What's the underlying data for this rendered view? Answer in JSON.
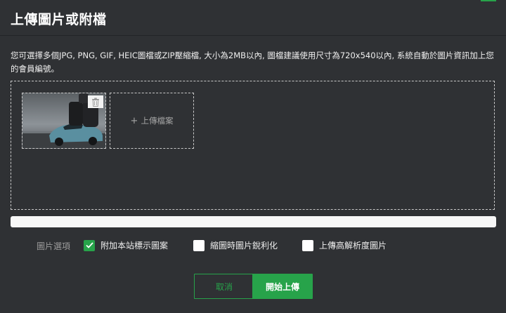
{
  "dialog": {
    "title": "上傳圖片或附檔",
    "description": "您可選擇多個JPG, PNG, GIF, HEIC圖檔或ZIP壓縮檔, 大小為2MB以內, 圖檔建議使用尺寸為720x540以內, 系統自動於圖片資訊加上您的會員編號。"
  },
  "dropzone": {
    "thumbnail": {
      "delete_icon": "trash-icon"
    },
    "upload_tile": {
      "icon": "plus-icon",
      "icon_glyph": "+",
      "label": "上傳檔案"
    }
  },
  "progress": {
    "fraction": 0
  },
  "options": {
    "label": "圖片選項",
    "items": [
      {
        "label": "附加本站標示圖案",
        "checked": true
      },
      {
        "label": "縮圖時圖片銳利化",
        "checked": false
      },
      {
        "label": "上傳高解析度圖片",
        "checked": false
      }
    ]
  },
  "buttons": {
    "cancel": "取消",
    "start": "開始上傳"
  },
  "colors": {
    "accent": "#27a34a",
    "background": "#2f3134"
  }
}
